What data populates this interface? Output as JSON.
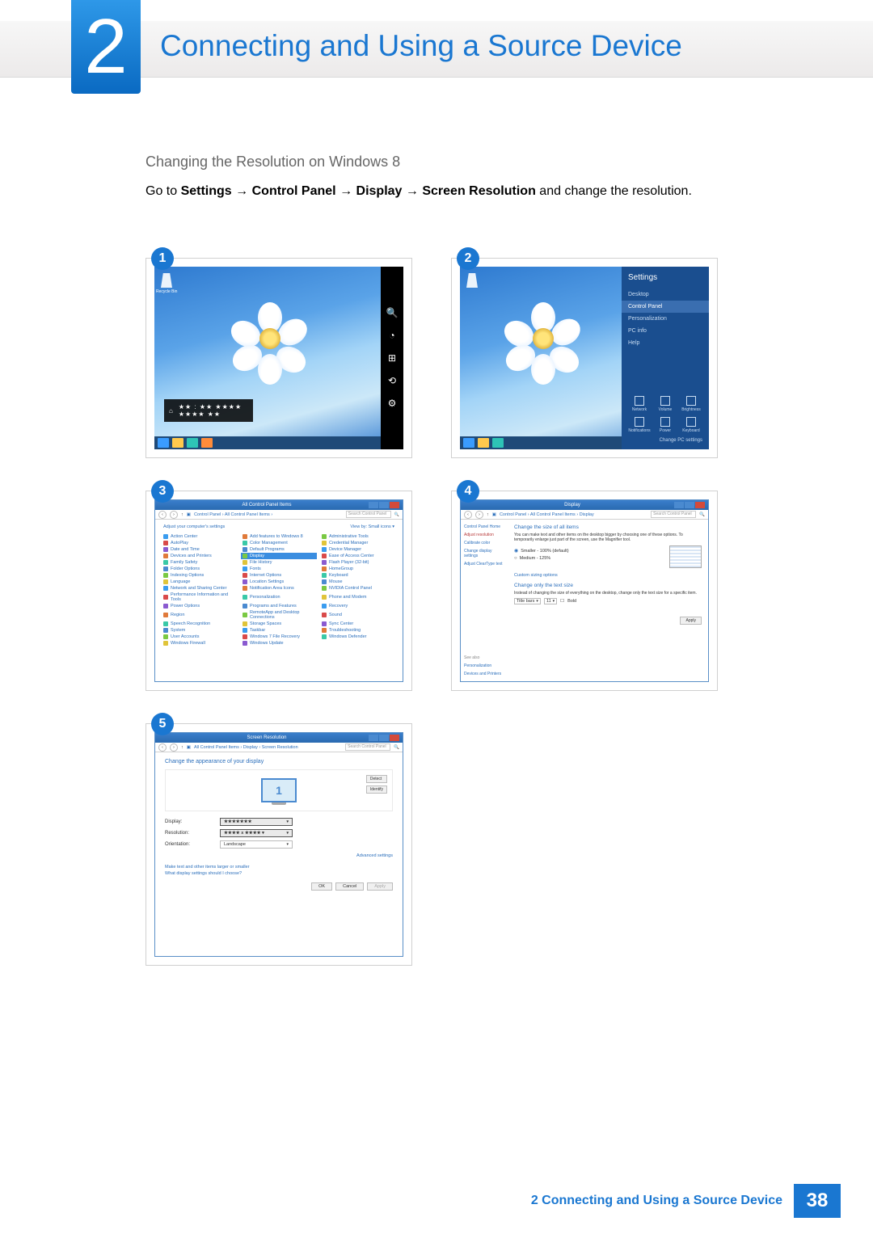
{
  "header": {
    "chapter_number": "2",
    "chapter_title": "Connecting and Using a Source Device"
  },
  "section": {
    "heading": "Changing the Resolution on Windows 8",
    "lead": "Go to ",
    "path": [
      "Settings",
      "Control Panel",
      "Display",
      "Screen Resolution"
    ],
    "tail": " and change the resolution."
  },
  "figures": {
    "f1": {
      "badge": "1",
      "recycle_label": "Recycle Bin",
      "clock": "★★ : ★★    ★★★★  ★★★★ ★★",
      "charms": [
        "Search",
        "Share",
        "Start",
        "Devices",
        "Settings"
      ]
    },
    "f2": {
      "badge": "2",
      "panel_title": "Settings",
      "items": [
        "Desktop",
        "Control Panel",
        "Personalization",
        "PC info",
        "Help"
      ],
      "tiles": [
        "Network",
        "Volume",
        "Brightness",
        "Notifications",
        "Power",
        "Keyboard"
      ],
      "change": "Change PC settings"
    },
    "f3": {
      "badge": "3",
      "title": "All Control Panel Items",
      "breadcrumb": "Control Panel  ›  All Control Panel Items  ›",
      "search_placeholder": "Search Control Panel",
      "adjust": "Adjust your computer's settings",
      "view_by": "View by:  Small icons ▾",
      "items_col1": [
        "Action Center",
        "AutoPlay",
        "Date and Time",
        "Devices and Printers",
        "Family Safety",
        "Folder Options",
        "Indexing Options",
        "Language",
        "Network and Sharing Center",
        "Performance Information and Tools",
        "Power Options",
        "Region",
        "Speech Recognition",
        "System",
        "User Accounts",
        "Windows Firewall"
      ],
      "items_col2": [
        "Add features to Windows 8",
        "Color Management",
        "Default Programs",
        "Display",
        "File History",
        "Fonts",
        "Internet Options",
        "Location Settings",
        "Notification Area Icons",
        "Personalization",
        "Programs and Features",
        "RemoteApp and Desktop Connections",
        "Storage Spaces",
        "Taskbar",
        "Windows 7 File Recovery",
        "Windows Update"
      ],
      "items_col3": [
        "Administrative Tools",
        "Credential Manager",
        "Device Manager",
        "Ease of Access Center",
        "Flash Player (32-bit)",
        "HomeGroup",
        "Keyboard",
        "Mouse",
        "NVIDIA Control Panel",
        "Phone and Modem",
        "Recovery",
        "Sound",
        "Sync Center",
        "Troubleshooting",
        "Windows Defender"
      ],
      "highlight_index": 3
    },
    "f4": {
      "badge": "4",
      "title": "Display",
      "breadcrumb": "Control Panel  ›  All Control Panel Items  ›  Display",
      "search_placeholder": "Search Control Panel",
      "side_home": "Control Panel Home",
      "side_links": [
        "Adjust resolution",
        "Calibrate color",
        "Change display settings",
        "Adjust ClearType text"
      ],
      "heading1": "Change the size of all items",
      "desc1": "You can make text and other items on the desktop bigger by choosing one of these options. To temporarily enlarge just part of the screen, use the Magnifier tool.",
      "radio1": "Smaller - 100% (default)",
      "radio2": "Medium - 125%",
      "custom": "Custom sizing options",
      "heading2": "Change only the text size",
      "desc2": "Instead of changing the size of everything on the desktop, change only the text size for a specific item.",
      "label_titlebars": "Title bars",
      "size_val": "11",
      "bold": "Bold",
      "apply": "Apply",
      "seealso_label": "See also",
      "seealso": [
        "Personalization",
        "Devices and Printers"
      ]
    },
    "f5": {
      "badge": "5",
      "title": "Screen Resolution",
      "breadcrumb": "All Control Panel Items  ›  Display  ›  Screen Resolution",
      "search_placeholder": "Search Control Panel",
      "heading": "Change the appearance of your display",
      "detect": "Detect",
      "identify": "Identify",
      "monitor_num": "1",
      "label_display": "Display:",
      "val_display": "★★★★★★★",
      "label_resolution": "Resolution:",
      "val_resolution": "★★★★ x ★★★★ ▾",
      "label_orientation": "Orientation:",
      "val_orientation": "Landscape",
      "advanced": "Advanced settings",
      "link1": "Make text and other items larger or smaller",
      "link2": "What display settings should I choose?",
      "btn_ok": "OK",
      "btn_cancel": "Cancel",
      "btn_apply": "Apply"
    }
  },
  "footer": {
    "text": "2 Connecting and Using a Source Device",
    "page": "38"
  },
  "colors": {
    "accent": "#1a77d1"
  }
}
